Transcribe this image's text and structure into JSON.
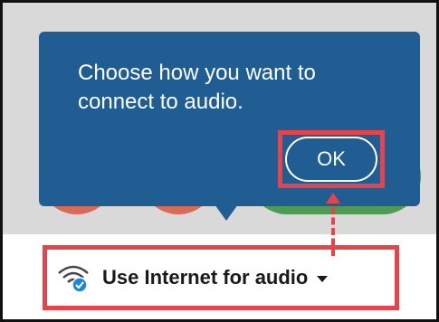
{
  "popover": {
    "message": "Choose how you want to connect to audio.",
    "ok_label": "OK"
  },
  "audio_selector": {
    "label": "Use Internet for audio",
    "icon": "wifi-check-icon",
    "dropdown_icon": "caret-down-icon"
  },
  "colors": {
    "popover_bg": "#1f5d93",
    "highlight": "#e7434b",
    "backdrop": "#d9d9d9"
  }
}
